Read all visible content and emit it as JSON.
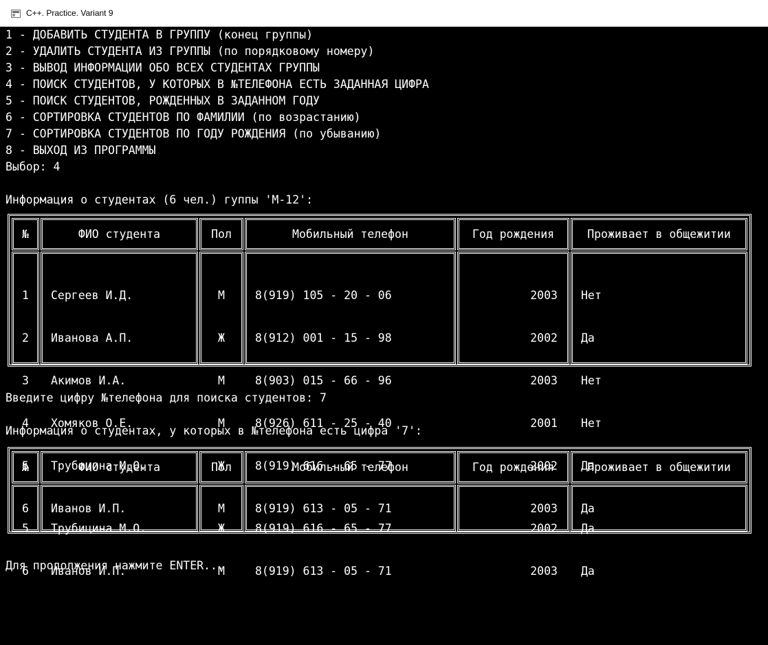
{
  "window": {
    "title": "C++. Practice. Variant 9",
    "icon": "console-app-icon"
  },
  "menu": [
    "1 - ДОБАВИТЬ СТУДЕНТА В ГРУППУ (конец группы)",
    "2 - УДАЛИТЬ СТУДЕНТА ИЗ ГРУППЫ (по порядковому номеру)",
    "3 - ВЫВОД ИНФОРМАЦИИ ОБО ВСЕХ СТУДЕНТАХ ГРУППЫ",
    "4 - ПОИСК СТУДЕНТОВ, У КОТОРЫХ В №ТЕЛЕФОНА ЕСТЬ ЗАДАННАЯ ЦИФРА",
    "5 - ПОИСК СТУДЕНТОВ, РОЖДЕННЫХ В ЗАДАННОМ ГОДУ",
    "6 - СОРТИРОВКА СТУДЕНТОВ ПО ФАМИЛИИ (по возрастанию)",
    "7 - СОРТИРОВКА СТУДЕНТОВ ПО ГОДУ РОЖДЕНИЯ (по убыванию)",
    "8 - ВЫХОД ИЗ ПРОГРАММЫ"
  ],
  "choice_line": "Выбор: 4",
  "table_headers": [
    "№",
    "ФИО студента",
    "Пол",
    "Мобильный телефон",
    "Год рождения",
    "Проживает в общежитии"
  ],
  "group_info_line": "Информация о студентах (6 чел.) гуппы 'М-12':",
  "students": [
    [
      "1",
      "Сергеев И.Д.",
      "М",
      "8(919) 105 - 20 - 06",
      "2003",
      "Нет"
    ],
    [
      "2",
      "Иванова А.П.",
      "Ж",
      "8(912) 001 - 15 - 98",
      "2002",
      "Да"
    ],
    [
      "3",
      "Акимов И.А.",
      "М",
      "8(903) 015 - 66 - 96",
      "2003",
      "Нет"
    ],
    [
      "4",
      "Хомяков О.Е.",
      "М",
      "8(926) 611 - 25 - 40",
      "2001",
      "Нет"
    ],
    [
      "5",
      "Трубицина М.О.",
      "Ж",
      "8(919) 616 - 65 - 77",
      "2002",
      "Да"
    ],
    [
      "6",
      "Иванов И.П.",
      "М",
      "8(919) 613 - 05 - 71",
      "2003",
      "Да"
    ]
  ],
  "search_prompt_line": "Введите цифру №телефона для поиска студентов: 7",
  "search_result_line": "Информация о студентах, у которых в №телефона есть цифра '7':",
  "search_results": [
    [
      "5",
      "Трубицина М.О.",
      "Ж",
      "8(919) 616 - 65 - 77",
      "2002",
      "Да"
    ],
    [
      "6",
      "Иванов И.П.",
      "М",
      "8(919) 613 - 05 - 71",
      "2003",
      "Да"
    ]
  ],
  "continue_line": "Для продолжения нажмите ENTER...",
  "colors": {
    "console_bg": "#000000",
    "console_fg": "#ffffff",
    "titlebar_bg": "#ffffff"
  }
}
